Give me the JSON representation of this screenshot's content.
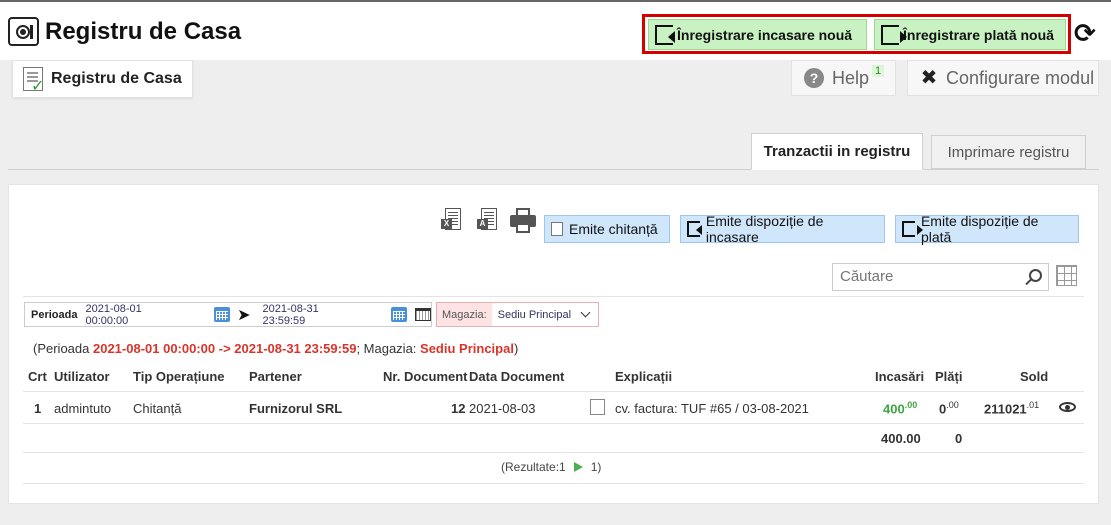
{
  "header": {
    "title": "Registru de Casa",
    "btn_income": "Înregistrare incasare nouă",
    "btn_payment": "Înregistrare plată nouă"
  },
  "subheader": {
    "breadcrumb": "Registru de Casa",
    "help_label": "Help",
    "help_badge": "1",
    "config_label": "Configurare modul"
  },
  "tabs": [
    {
      "label": "Tranzactii in registru",
      "active": true
    },
    {
      "label": "Imprimare registru",
      "active": false
    }
  ],
  "toolbar": {
    "btn_receipt": "Emite chitanță",
    "btn_income_order": "Emite dispoziție de incasare",
    "btn_payment_order": "Emite dispoziție de plată",
    "search_placeholder": "Căutare"
  },
  "filters": {
    "period_label": "Perioada",
    "date_from": "2021-08-01 00:00:00",
    "date_to": "2021-08-31 23:59:59",
    "store_label": "Magazia:",
    "store_value": "Sediu Principal"
  },
  "summary": {
    "prefix": "(Perioada ",
    "period_range": "2021-08-01 00:00:00 -> 2021-08-31 23:59:59",
    "mid": "; Magazia: ",
    "store": "Sediu Principal",
    "suffix": ")"
  },
  "table": {
    "columns": [
      "Crt",
      "Utilizator",
      "Tip Operațiune",
      "Partener",
      "Nr. Document",
      "Data Document",
      "Explicații",
      "Incasări",
      "Plăți",
      "Sold"
    ],
    "rows": [
      {
        "crt": "1",
        "user": "admintuto",
        "type": "Chitanță",
        "partner": "Furnizorul SRL",
        "doc_no": "12",
        "doc_date": "2021-08-03",
        "explanation": "cv. factura: TUF #65 / 03-08-2021",
        "income_int": "400",
        "income_dec": ".00",
        "payment_int": "0",
        "payment_dec": ".00",
        "balance_int": "211021",
        "balance_dec": ".01"
      }
    ],
    "totals": {
      "income": "400.00",
      "payment": "0"
    }
  },
  "pager": {
    "results": "(Rezultate:1",
    "page": "1)"
  },
  "colors": {
    "action_border": "#d40000",
    "green_btn": "#c8f2c2",
    "blue_btn": "#cfe6fb",
    "summary_red": "#d9342b",
    "income_green": "#3fa63f"
  }
}
